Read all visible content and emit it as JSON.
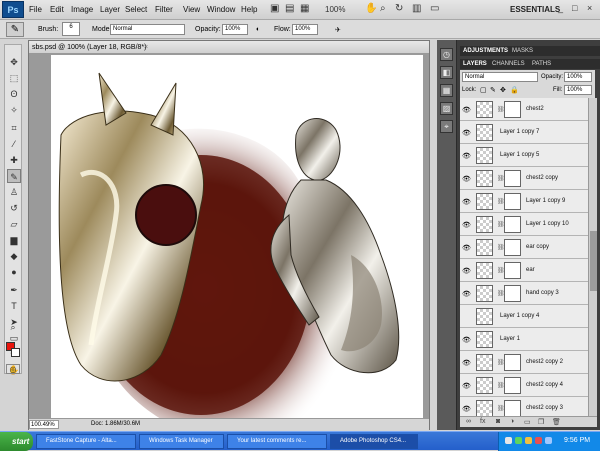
{
  "menubar": {
    "logo": "Ps",
    "menus": [
      "File",
      "Edit",
      "Image",
      "Layer",
      "Select",
      "Filter",
      "View",
      "Window",
      "Help"
    ],
    "zoom": "100%",
    "workspace": "ESSENTIALS",
    "window_buttons": [
      "_",
      "□",
      "×"
    ]
  },
  "options": {
    "brush_label": "Brush:",
    "brush_size": "6",
    "mode_label": "Mode:",
    "mode_value": "Normal",
    "opacity_label": "Opacity:",
    "opacity_value": "100%",
    "flow_label": "Flow:",
    "flow_value": "100%"
  },
  "document": {
    "tab_title": "sbs.psd @ 100% (Layer 18, RGB/8*)",
    "tab_close": "×",
    "zoom_field": "100.49%",
    "doc_size": "Doc: 1.86M/30.6M"
  },
  "panels": {
    "adjustments_tab": "ADJUSTMENTS",
    "masks_tab": "MASKS",
    "layers_tab": "LAYERS",
    "channels_tab": "CHANNELS",
    "paths_tab": "PATHS",
    "blend_mode": "Normal",
    "opacity_label": "Opacity:",
    "opacity_value": "100%",
    "lock_label": "Lock:",
    "fill_label": "Fill:",
    "fill_value": "100%"
  },
  "layers": [
    {
      "name": "chest2",
      "visible": true,
      "has_mask": true
    },
    {
      "name": "Layer 1 copy 7",
      "visible": true,
      "has_mask": false
    },
    {
      "name": "Layer 1 copy 5",
      "visible": true,
      "has_mask": false
    },
    {
      "name": "chest2 copy",
      "visible": true,
      "has_mask": true
    },
    {
      "name": "Layer 1 copy 9",
      "visible": true,
      "has_mask": true
    },
    {
      "name": "Layer 1 copy 10",
      "visible": true,
      "has_mask": true
    },
    {
      "name": "ear copy",
      "visible": true,
      "has_mask": true
    },
    {
      "name": "ear",
      "visible": true,
      "has_mask": true
    },
    {
      "name": "hand copy 3",
      "visible": true,
      "has_mask": true
    },
    {
      "name": "Layer 1 copy 4",
      "visible": false,
      "has_mask": false
    },
    {
      "name": "Layer 1",
      "visible": true,
      "has_mask": false
    },
    {
      "name": "chest2 copy 2",
      "visible": true,
      "has_mask": true
    },
    {
      "name": "chest2 copy 4",
      "visible": true,
      "has_mask": true
    },
    {
      "name": "chest2 copy 3",
      "visible": true,
      "has_mask": true
    }
  ],
  "taskbar": {
    "start": "start",
    "buttons": [
      "FastStone Capture - Alta...",
      "Windows Task Manager",
      "Your latest comments re...",
      "Adobe Photoshop CS4..."
    ],
    "clock": "9:56 PM"
  },
  "colors": {
    "foreground": "#e8140c",
    "background": "#ffffff",
    "panel_dark": "#3e3e3e",
    "taskbar_blue": "#245fcb"
  }
}
